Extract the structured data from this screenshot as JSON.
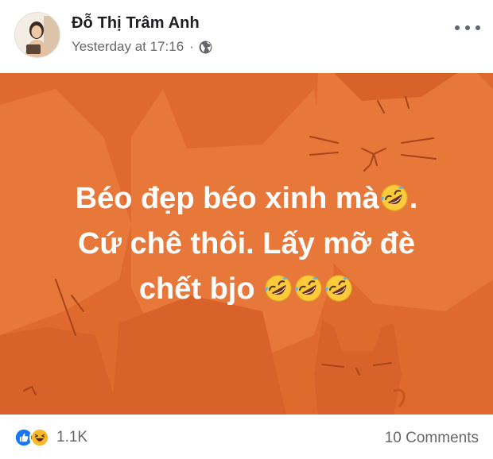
{
  "post": {
    "author_name": "Đỗ Thị Trâm Anh",
    "timestamp": "Yesterday at 17:16",
    "separator": "·",
    "privacy_icon": "globe-icon",
    "more_icon": "more-horizontal-icon",
    "background_color": "#e06a2e",
    "text_lines": [
      "Béo đẹp béo xinh mà",
      "Cứ chê thôi. Lấy mỡ đè",
      "chết bjo"
    ],
    "line1_suffix": ".",
    "emoji_icon": "rolling-on-floor-laughing-icon"
  },
  "footer": {
    "reaction_icons": [
      "like-icon",
      "haha-icon"
    ],
    "reaction_count": "1.1K",
    "comments_label": "10 Comments",
    "like_color": "#1877f2",
    "haha_color": "#f7b928"
  }
}
